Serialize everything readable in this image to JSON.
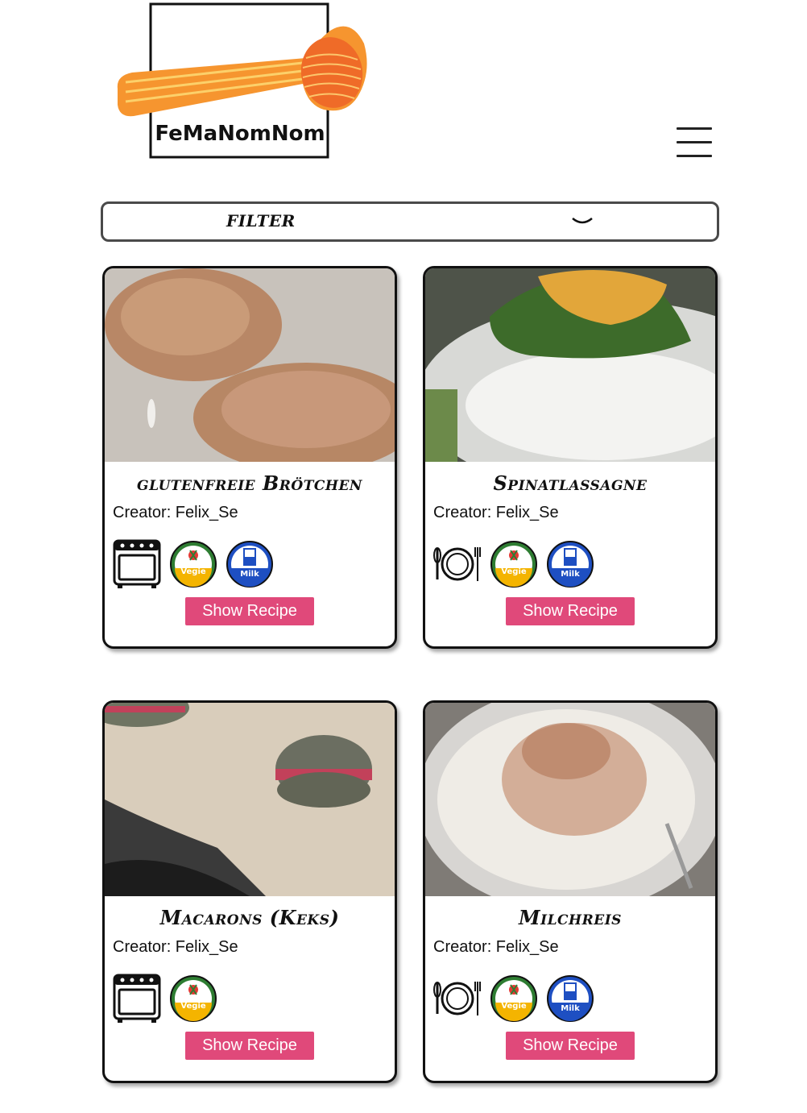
{
  "header": {
    "logo_text": "FeMaNomNom",
    "menu_icon": "hamburger-menu-icon"
  },
  "filter": {
    "label": "FILTER",
    "icon": "chevron-down-icon"
  },
  "recipes": [
    {
      "title": "glutenfreie Brötchen",
      "creator": "Creator: Felix_Se",
      "icons": [
        "oven-icon",
        "vegie-badge-icon",
        "milk-badge-icon"
      ],
      "button": "Show Recipe"
    },
    {
      "title": "Spinatlassagne",
      "creator": "Creator: Felix_Se",
      "icons": [
        "plate-cutlery-icon",
        "vegie-badge-icon",
        "milk-badge-icon"
      ],
      "button": "Show Recipe"
    },
    {
      "title": "Macarons (Keks)",
      "creator": "Creator: Felix_Se",
      "icons": [
        "oven-icon",
        "vegie-badge-icon"
      ],
      "button": "Show Recipe"
    },
    {
      "title": "Milchreis",
      "creator": "Creator: Felix_Se",
      "icons": [
        "plate-cutlery-icon",
        "vegie-badge-icon",
        "milk-badge-icon"
      ],
      "button": "Show Recipe"
    }
  ],
  "badges": {
    "vegie_label": "Vegie",
    "milk_label": "Milk"
  },
  "colors": {
    "button_bg": "#e0497a",
    "vegie_ring": "#2e7d32",
    "milk_ring": "#1e4fc2"
  }
}
